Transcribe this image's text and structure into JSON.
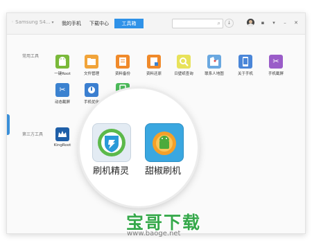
{
  "titlebar": {
    "device_name": "Samsung S4...",
    "tabs": [
      {
        "label": "我的手机",
        "active": false
      },
      {
        "label": "下载中心",
        "active": false
      },
      {
        "label": "工具箱",
        "active": true
      }
    ],
    "search_placeholder": ""
  },
  "sections": {
    "common_title": "常用工具",
    "third_party_title": "第三方工具"
  },
  "tools": [
    {
      "label": "一键Root",
      "icon": "android-root-icon",
      "color": "#7ab93a"
    },
    {
      "label": "文件管理",
      "icon": "folder-icon",
      "color": "#f1a43a"
    },
    {
      "label": "资料备份",
      "icon": "backup-icon",
      "color": "#f08a2a"
    },
    {
      "label": "资料还原",
      "icon": "restore-icon",
      "color": "#f08a2a"
    },
    {
      "label": "日壁纸查询",
      "icon": "magnifier-icon",
      "color": "#e8e25a"
    },
    {
      "label": "联系人地图",
      "icon": "map-icon",
      "color": "#6aa8e0"
    },
    {
      "label": "关于手机",
      "icon": "phone-info-icon",
      "color": "#4a86d8"
    },
    {
      "label": "手机截屏",
      "icon": "scissors-icon",
      "color": "#9a5cc8"
    },
    {
      "label": "动态截屏",
      "icon": "scissors-icon",
      "color": "#3b82d0"
    },
    {
      "label": "手机优化",
      "icon": "optimize-icon",
      "color": "#3b7fd0"
    },
    {
      "label": "",
      "icon": "green-phone-icon",
      "color": "#4cba5a"
    }
  ],
  "third_party": [
    {
      "label": "KingRoot",
      "icon": "kingroot-icon",
      "color": "#1f5fa8"
    }
  ],
  "magnified": [
    {
      "label": "刷机精灵",
      "icon": "shuaji-shield-icon"
    },
    {
      "label": "甜椒刷机",
      "icon": "tianjiao-android-icon"
    }
  ],
  "watermark": {
    "brand": "宝哥下载",
    "url": "www.baoge.net"
  },
  "colors": {
    "accent": "#2f92e8",
    "watermark_green": "#35a84a"
  }
}
